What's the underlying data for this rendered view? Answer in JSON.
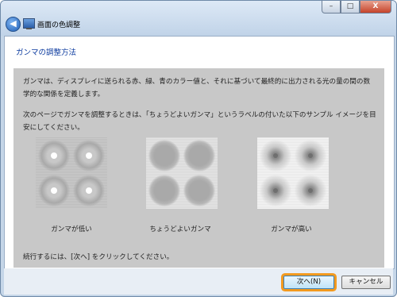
{
  "window": {
    "title": "画面の色調整",
    "icons": {
      "back": "back-arrow-icon",
      "app": "monitor-icon"
    },
    "caption": {
      "minimize": "–",
      "maximize": "□",
      "close": "X"
    }
  },
  "content": {
    "heading": "ガンマの調整方法",
    "paragraph1": "ガンマは、ディスプレイに送られる赤、緑、青のカラー値と、それに基づいて最終的に出力される光の量の間の数学的な関係を定義します。",
    "paragraph2": "次のページでガンマを調整するときは、「ちょうどよいガンマ」というラベルの付いた以下のサンプル イメージを目安にしてください。",
    "samples": [
      {
        "label": "ガンマが低い"
      },
      {
        "label": "ちょうどよいガンマ"
      },
      {
        "label": "ガンマが高い"
      }
    ],
    "continue_text": "続行するには、[次へ] をクリックしてください。"
  },
  "footer": {
    "next_label": "次へ(N)",
    "cancel_label": "キャンセル"
  },
  "colors": {
    "heading": "#0b3a9e",
    "panel": "#c8c8c8",
    "focus_ring": "#f39a1f"
  }
}
